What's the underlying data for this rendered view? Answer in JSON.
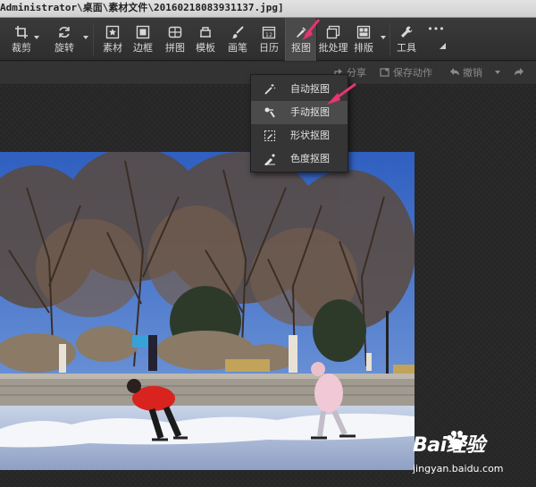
{
  "window": {
    "title": "Administrator\\桌面\\素材文件\\20160218083931137.jpg]"
  },
  "toolbar": {
    "items": [
      {
        "label": "裁剪",
        "icon": "crop-icon"
      },
      {
        "label": "旋转",
        "icon": "rotate-icon"
      },
      {
        "label": "素材",
        "icon": "sticker-icon"
      },
      {
        "label": "边框",
        "icon": "frame-icon"
      },
      {
        "label": "拼图",
        "icon": "collage-icon"
      },
      {
        "label": "模板",
        "icon": "template-icon"
      },
      {
        "label": "画笔",
        "icon": "brush-icon"
      },
      {
        "label": "日历",
        "icon": "calendar-icon",
        "icon_text": "12"
      },
      {
        "label": "抠图",
        "icon": "cutout-icon",
        "active": true
      },
      {
        "label": "批处理",
        "icon": "batch-icon"
      },
      {
        "label": "排版",
        "icon": "layout-icon"
      },
      {
        "label": "工具",
        "icon": "wrench-icon"
      }
    ],
    "more_label": "•••"
  },
  "subbar": {
    "share_label": "分享",
    "save_action_label": "保存动作",
    "undo_label": "撤销"
  },
  "cutout_menu": {
    "items": [
      {
        "label": "自动抠图",
        "icon": "magic-wand-icon"
      },
      {
        "label": "手动抠图",
        "icon": "manual-brush-icon",
        "hovered": true
      },
      {
        "label": "形状抠图",
        "icon": "shape-pen-icon"
      },
      {
        "label": "色度抠图",
        "icon": "color-picker-icon"
      }
    ]
  },
  "watermark": {
    "brand": "Bai经验",
    "url": "jingyan.baidu.com"
  },
  "colors": {
    "accent_arrow": "#e8356e",
    "toolbar_bg": "#333333",
    "menu_bg": "#353535",
    "sky": "#4a78c8"
  }
}
